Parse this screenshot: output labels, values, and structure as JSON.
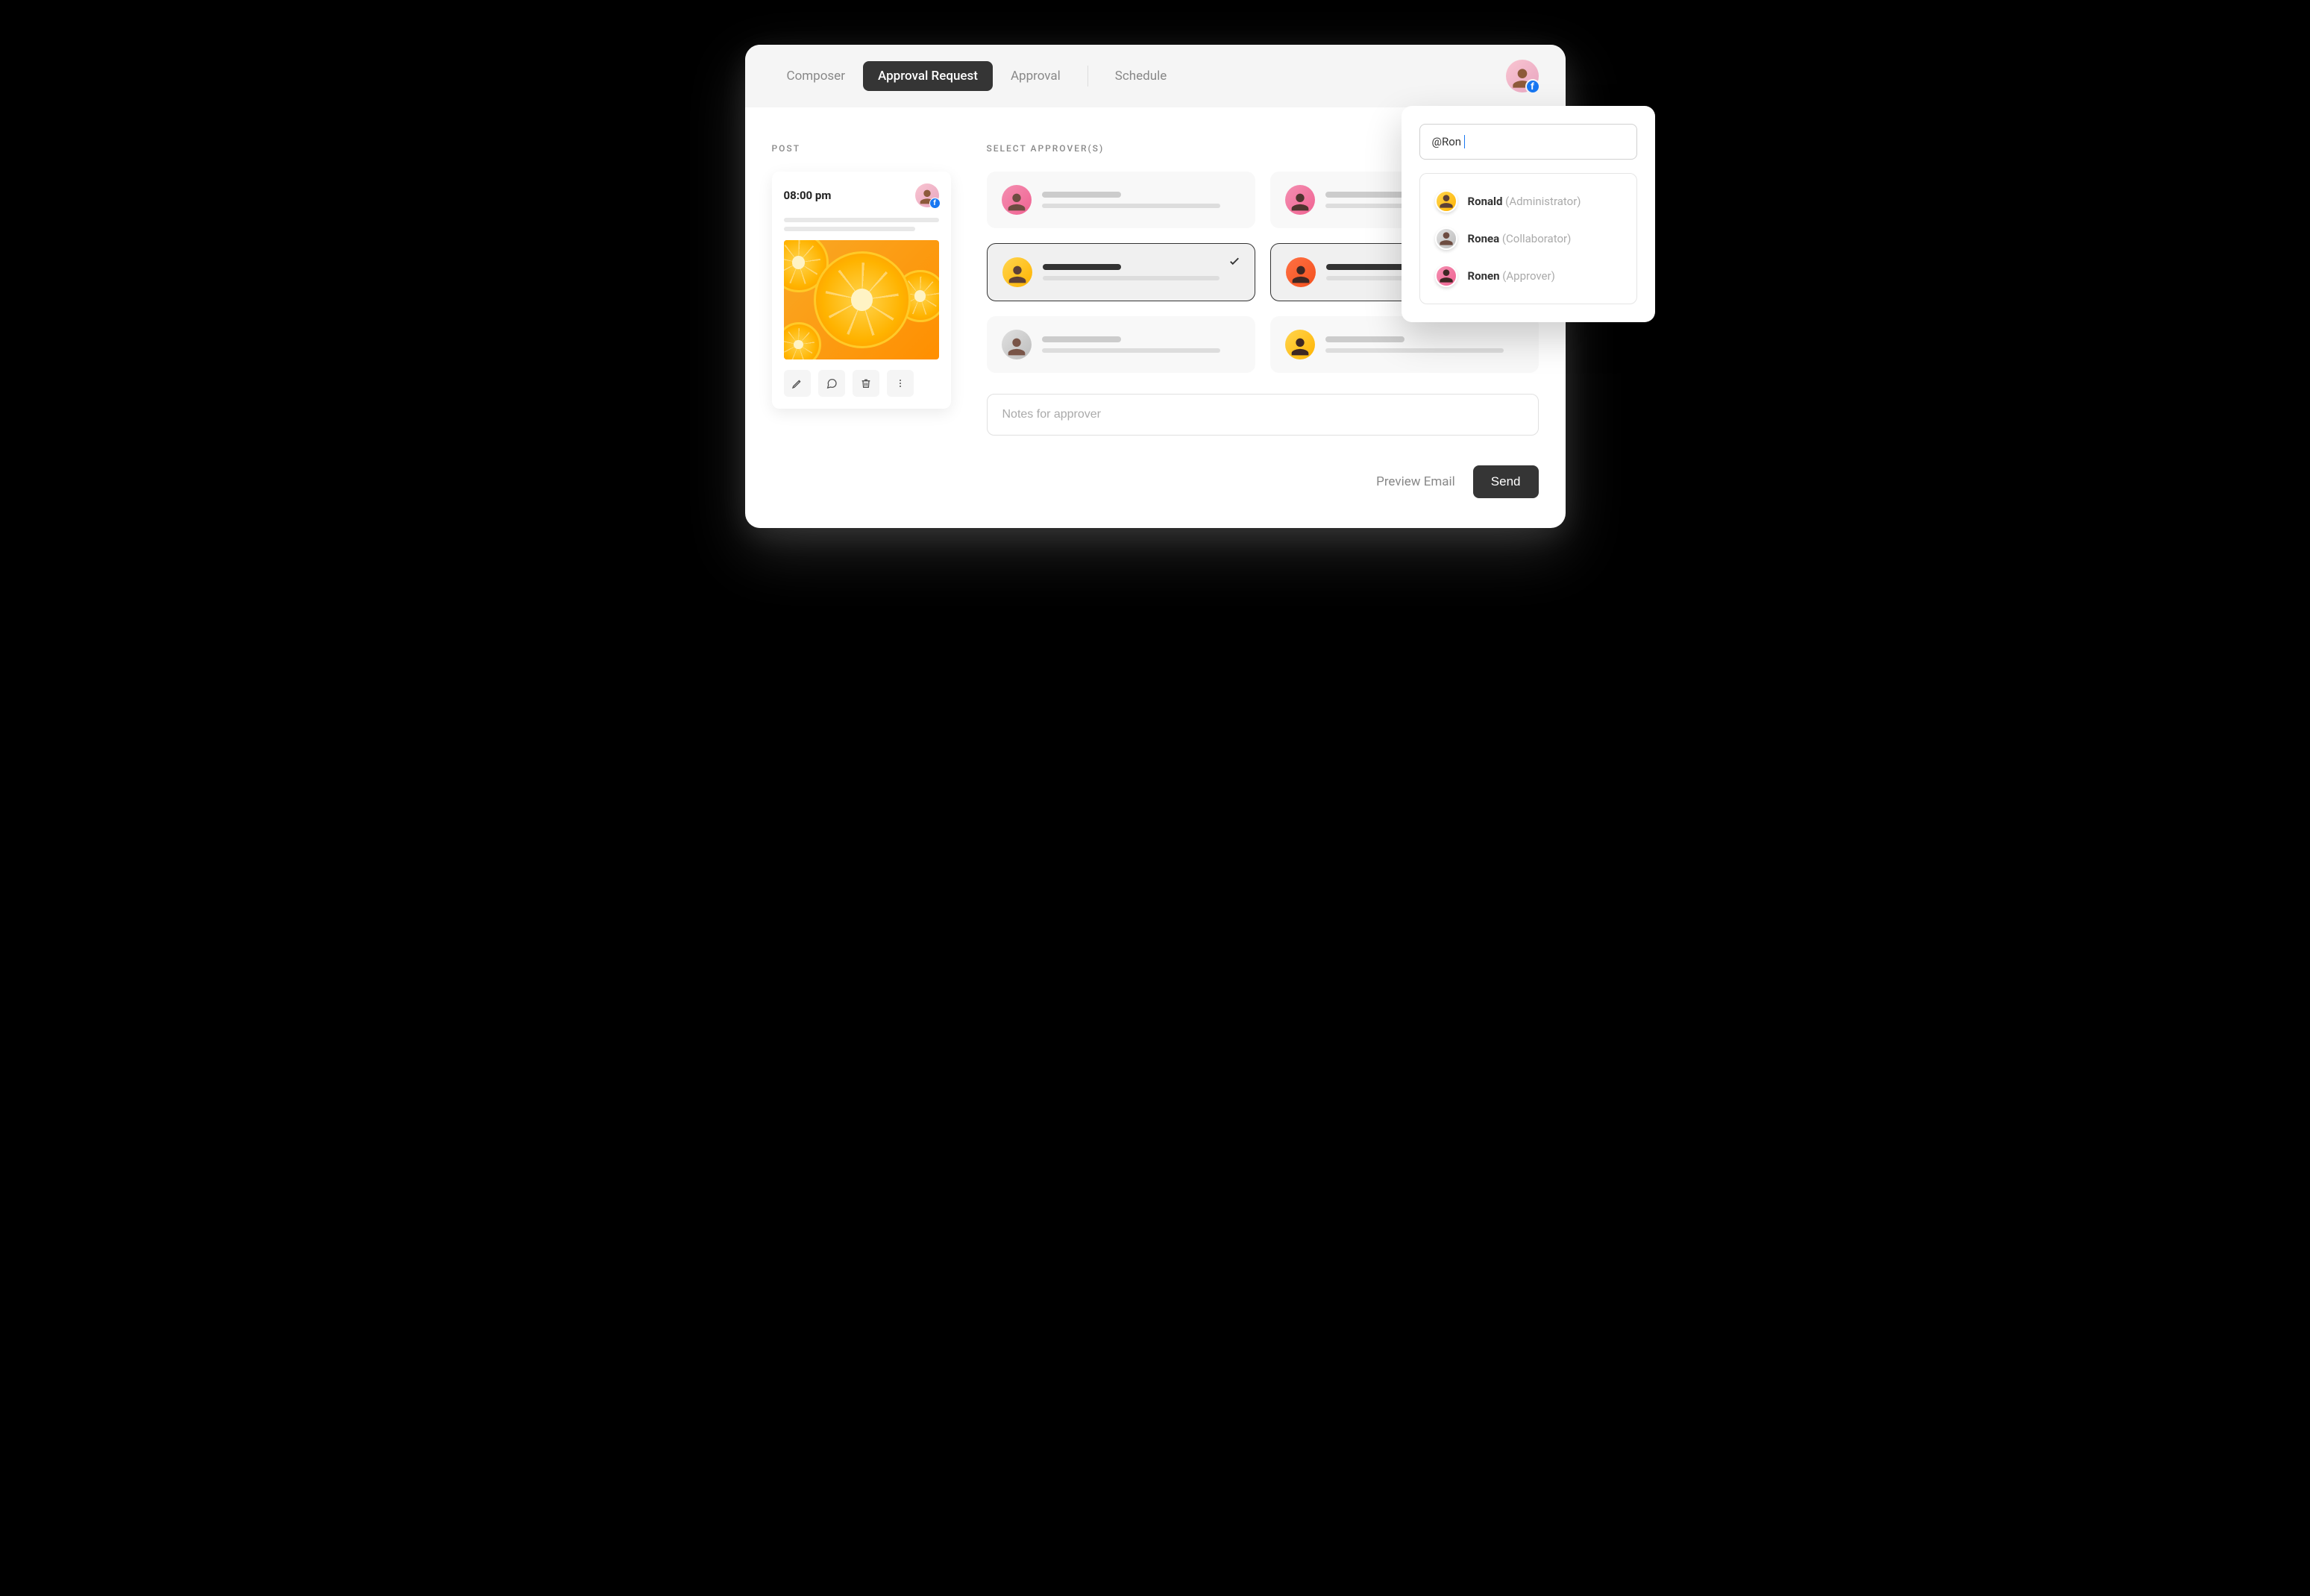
{
  "header": {
    "tabs": [
      "Composer",
      "Approval Request",
      "Approval",
      "Schedule"
    ],
    "active_tab_index": 1,
    "fb_badge": "f"
  },
  "post": {
    "section_label": "POST",
    "time": "08:00 pm",
    "fb_badge": "f",
    "actions": [
      "edit",
      "comment",
      "delete",
      "more"
    ]
  },
  "approvers": {
    "section_label": "SELECT APPROVER(S)",
    "cards": [
      {
        "selected": false,
        "avatar_color": "pink"
      },
      {
        "selected": false,
        "avatar_color": "pink"
      },
      {
        "selected": true,
        "avatar_color": "yellow"
      },
      {
        "selected": true,
        "avatar_color": "orange"
      },
      {
        "selected": false,
        "avatar_color": "grey"
      },
      {
        "selected": false,
        "avatar_color": "yellow"
      }
    ],
    "notes_placeholder": "Notes for approver"
  },
  "footer": {
    "preview_label": "Preview Email",
    "send_label": "Send"
  },
  "mention": {
    "input_value": "@Ron",
    "suggestions": [
      {
        "name": "Ronald",
        "role": "Administrator",
        "avatar_color": "yellow"
      },
      {
        "name": "Ronea",
        "role": "Collaborator",
        "avatar_color": "grey"
      },
      {
        "name": "Ronen",
        "role": "Approver",
        "avatar_color": "pink"
      }
    ]
  }
}
